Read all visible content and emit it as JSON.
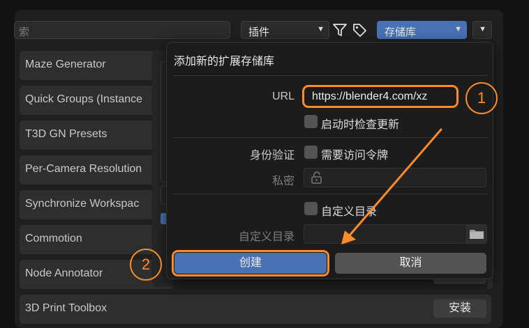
{
  "search": {
    "placeholder_fragment": "索"
  },
  "toolbar": {
    "type_dropdown": "插件",
    "repo_dropdown": "存储库",
    "filter_icon": "funnel-icon",
    "tag_icon": "tag-icon"
  },
  "extensions": [
    {
      "name": "Maze Generator"
    },
    {
      "name": "Quick Groups (Instance"
    },
    {
      "name": "T3D GN Presets"
    },
    {
      "name": "Per-Camera Resolution"
    },
    {
      "name": "Synchronize Workspac"
    },
    {
      "name": "Commotion"
    },
    {
      "name": "Node Annotator"
    },
    {
      "name": "3D Print Toolbox"
    }
  ],
  "install_label": "安装",
  "dialog": {
    "title": "添加新的扩展存储库",
    "url_label": "URL",
    "url_value": "https://blender4.com/xz",
    "check_updates_label": "启动时检查更新",
    "auth_label": "身份验证",
    "token_required_label": "需要访问令牌",
    "secret_label": "私密",
    "custom_dir_checkbox_label": "自定义目录",
    "custom_dir_label": "自定义目录",
    "create_button": "创建",
    "cancel_button": "取消"
  },
  "annotations": {
    "badge_1": "1",
    "badge_2": "2",
    "accent_color": "#ff8c2b"
  },
  "colors": {
    "primary_button": "#4772b3",
    "repo_dropdown": "#4772b3"
  }
}
